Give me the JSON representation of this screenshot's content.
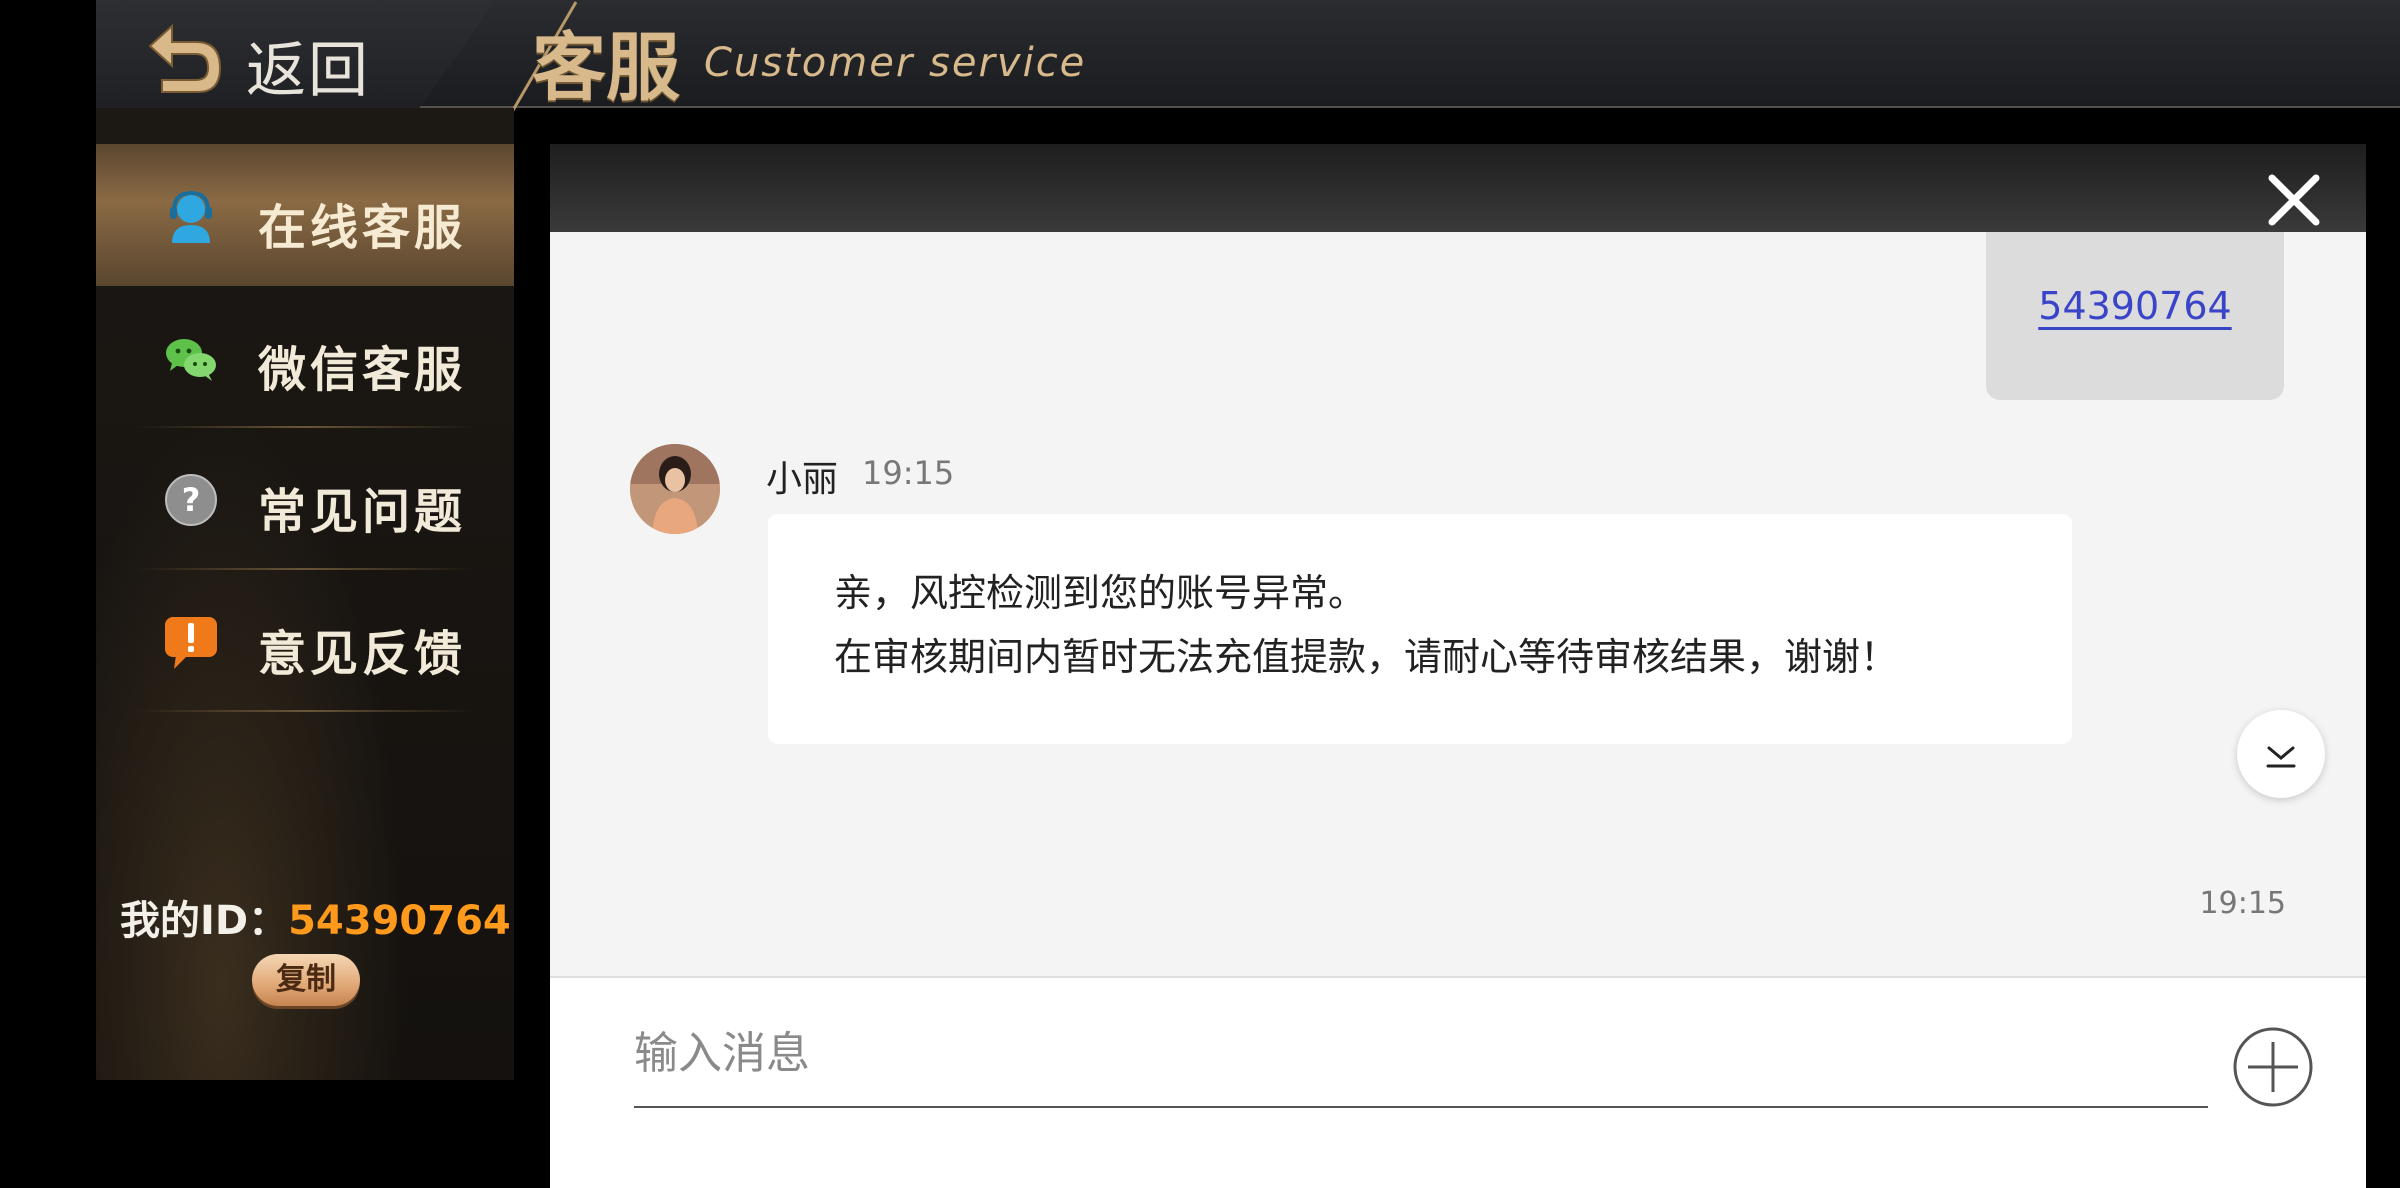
{
  "header": {
    "back_label": "返回",
    "title": "客服",
    "subtitle": "Customer service"
  },
  "sidebar": {
    "items": [
      {
        "label": "在线客服",
        "icon": "headset-person-icon",
        "active": true
      },
      {
        "label": "微信客服",
        "icon": "wechat-icon",
        "active": false
      },
      {
        "label": "常见问题",
        "icon": "question-icon",
        "active": false
      },
      {
        "label": "意见反馈",
        "icon": "exclamation-bubble-icon",
        "active": false
      }
    ],
    "my_id_label": "我的ID：",
    "my_id_value": "54390764",
    "copy_label": "复制"
  },
  "chat": {
    "my_message": {
      "link_text": "54390764"
    },
    "agent_message": {
      "name": "小丽",
      "time": "19:15",
      "lines": [
        "亲，风控检测到您的账号异常。",
        "在审核期间内暂时无法充值提款，请耐心等待审核结果，谢谢！"
      ]
    },
    "bottom_time": "19:15",
    "input_placeholder": "输入消息"
  },
  "colors": {
    "accent_gold": "#d7b98c",
    "id_orange": "#ff9a1c",
    "link_blue": "#3a44c9"
  }
}
